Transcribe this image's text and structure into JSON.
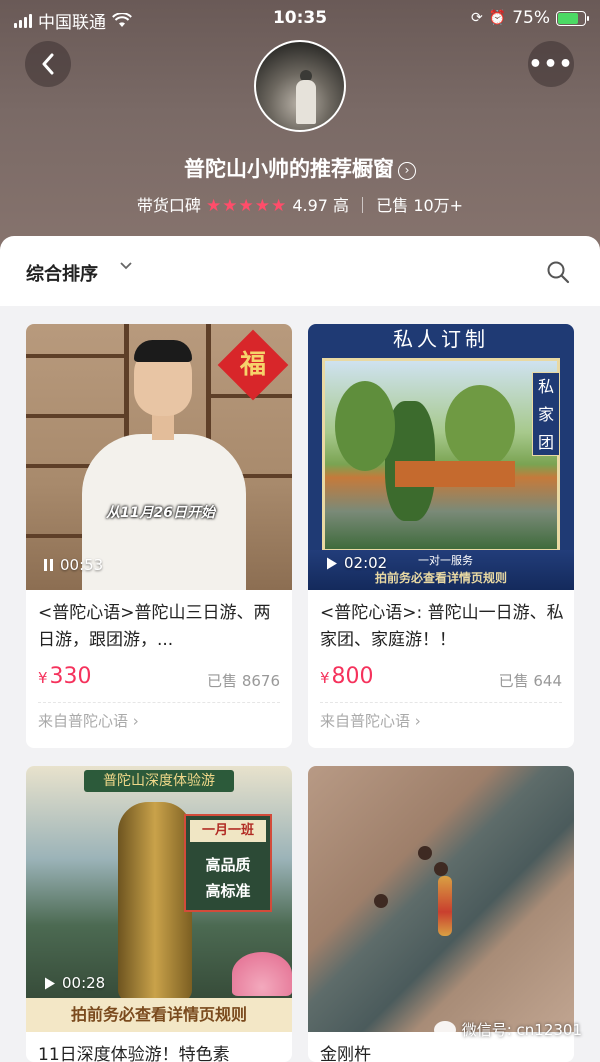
{
  "status_bar": {
    "carrier": "中国联通",
    "time": "10:35",
    "battery": "75%"
  },
  "header": {
    "shop_name": "普陀山小帅的推荐橱窗",
    "reputation_label": "带货口碑",
    "rating_stars": "★★★★★",
    "rating_value": "4.97",
    "rating_level": "高",
    "sold_label": "已售 10万+",
    "more_icon": "•••"
  },
  "sort": {
    "label": "综合排序"
  },
  "products": [
    {
      "title": "<普陀心语>普陀山三日游、两日游，跟团游，...",
      "price": "330",
      "sold": "已售 8676",
      "source": "来自普陀心语 ›",
      "duration": "00:53",
      "overlay_text": "从11月26日开始",
      "badge_text": "福"
    },
    {
      "title": "<普陀心语>: 普陀山一日游、私家团、家庭游！！",
      "price": "800",
      "sold": "已售 644",
      "source": "来自普陀心语 ›",
      "duration": "02:02",
      "banner": "私人订制",
      "side_text": "私家团",
      "sub_tag": "一对一服务",
      "rules": "拍前务必查看详情页规则"
    },
    {
      "title": "11日深度体验游！特色素",
      "duration": "00:28",
      "banner": "普陀山深度体验游",
      "badge_top": "一月一班",
      "badge_line1": "高品质",
      "badge_line2": "高标准",
      "rules": "拍前务必查看详情页规则"
    },
    {
      "title": "金刚杵"
    }
  ],
  "watermark": {
    "text": "微信号: cn12301"
  },
  "colors": {
    "price": "#f5325c",
    "stars": "#ff4d6a",
    "header_bg": "#7a6a66"
  }
}
